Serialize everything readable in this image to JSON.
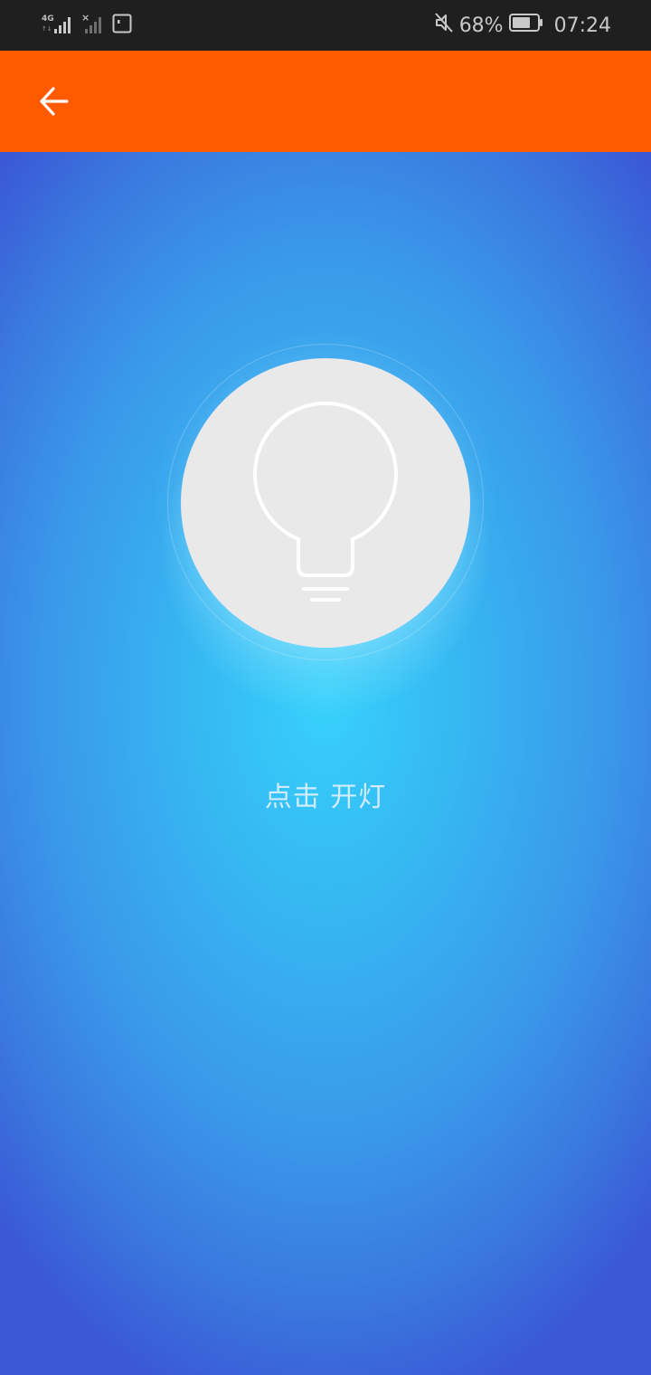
{
  "status_bar": {
    "network": "4G",
    "battery": "68%",
    "time": "07:24",
    "icons": [
      "signal-4g-icon",
      "signal-off-icon",
      "sim-card-icon",
      "mute-icon",
      "battery-icon"
    ]
  },
  "app_bar": {
    "title": "",
    "back_icon": "arrow-left-icon",
    "color": "#ff5a00"
  },
  "main": {
    "lamp_icon": "light-bulb-icon",
    "hint_text": "点击 开灯",
    "colors": {
      "center": "#37d1fb",
      "edge": "#3b56d6",
      "button": "#e9e9e9"
    }
  }
}
